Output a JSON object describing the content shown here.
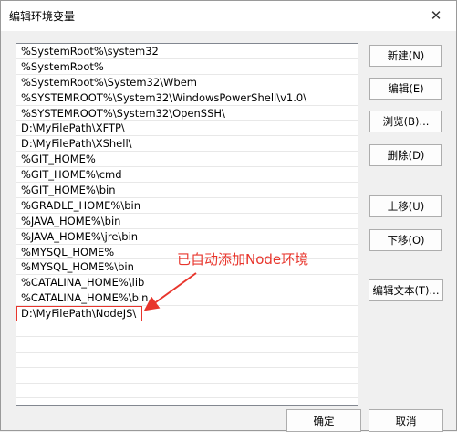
{
  "window": {
    "title": "编辑环境变量",
    "close_glyph": "✕"
  },
  "list": {
    "items": [
      "%SystemRoot%\\system32",
      "%SystemRoot%",
      "%SystemRoot%\\System32\\Wbem",
      "%SYSTEMROOT%\\System32\\WindowsPowerShell\\v1.0\\",
      "%SYSTEMROOT%\\System32\\OpenSSH\\",
      "D:\\MyFilePath\\XFTP\\",
      "D:\\MyFilePath\\XShell\\",
      "%GIT_HOME%",
      "%GIT_HOME%\\cmd",
      "%GIT_HOME%\\bin",
      "%GRADLE_HOME%\\bin",
      "%JAVA_HOME%\\bin",
      "%JAVA_HOME%\\jre\\bin",
      "%MYSQL_HOME%",
      "%MYSQL_HOME%\\bin",
      "%CATALINA_HOME%\\lib",
      "%CATALINA_HOME%\\bin",
      "D:\\MyFilePath\\NodeJS\\"
    ]
  },
  "buttons": {
    "new": "新建(N)",
    "edit": "编辑(E)",
    "browse": "浏览(B)...",
    "delete": "删除(D)",
    "move_up": "上移(U)",
    "move_down": "下移(O)",
    "edit_text": "编辑文本(T)...",
    "ok": "确定",
    "cancel": "取消"
  },
  "annotation": {
    "text": "已自动添加Node环境",
    "color": "#e8352c"
  }
}
